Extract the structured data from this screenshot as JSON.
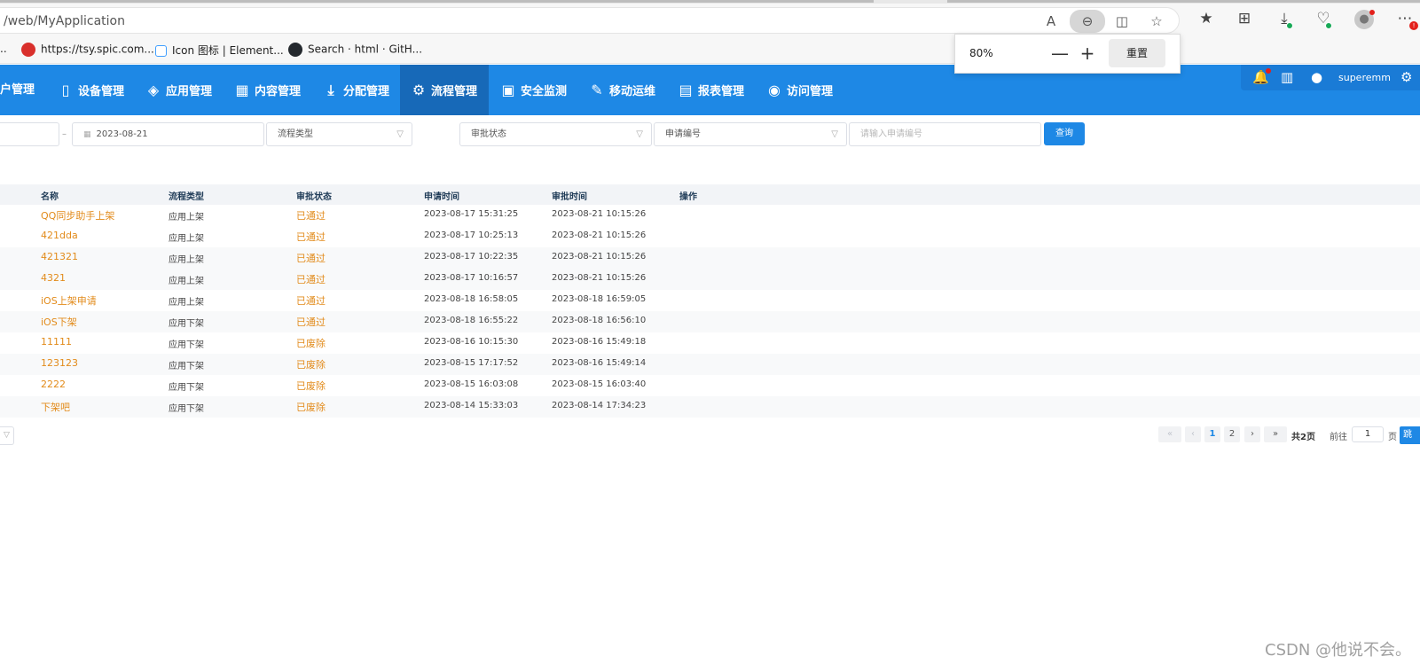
{
  "browser": {
    "url": "/web/MyApplication",
    "bookmarks": [
      {
        "label": "..",
        "icon": "ellipsis-icon"
      },
      {
        "label": "https://tsy.spic.com...",
        "icon": "site-favicon"
      },
      {
        "label": "Icon 图标 | Element...",
        "icon": "element-favicon"
      },
      {
        "label": "Search · html · GitH...",
        "icon": "github-icon"
      }
    ],
    "zoom": {
      "value": "80%",
      "minus": "—",
      "plus": "+",
      "reset": "重置"
    },
    "toolbar_icons": [
      "read-aloud-icon",
      "zoom-out-icon",
      "split-screen-icon",
      "favorite-star-icon",
      "favorites-icon",
      "collections-icon",
      "downloads-icon",
      "performance-icon",
      "profile-icon",
      "more-icon"
    ],
    "badge": "!"
  },
  "nav": {
    "items": [
      {
        "label": "户管理",
        "icon": ""
      },
      {
        "label": "设备管理",
        "icon": "device-icon"
      },
      {
        "label": "应用管理",
        "icon": "layers-icon"
      },
      {
        "label": "内容管理",
        "icon": "grid-icon"
      },
      {
        "label": "分配管理",
        "icon": "download-icon"
      },
      {
        "label": "流程管理",
        "icon": "gear-flow-icon"
      },
      {
        "label": "安全监测",
        "icon": "monitor-icon"
      },
      {
        "label": "移动运维",
        "icon": "wrench-icon"
      },
      {
        "label": "报表管理",
        "icon": "report-icon"
      },
      {
        "label": "访问管理",
        "icon": "access-icon"
      }
    ],
    "active_index": 5,
    "right": {
      "user": "superemm",
      "icons": [
        "bell-icon",
        "dashboard-icon",
        "user-icon",
        "settings-icon"
      ]
    }
  },
  "filters": {
    "date_sep": "–",
    "date_end": "2023-08-21",
    "process_type": "流程类型",
    "approval_status": "审批状态",
    "apply_no_select": "申请编号",
    "apply_no_placeholder": "请输入申请编号",
    "query": "查询"
  },
  "table": {
    "headers": [
      "名称",
      "流程类型",
      "审批状态",
      "申请时间",
      "审批时间",
      "操作"
    ],
    "rows": [
      {
        "name": "QQ同步助手上架",
        "type": "应用上架",
        "status": "已通过",
        "applied": "2023-08-17 15:31:25",
        "approved": "2023-08-21 10:15:26"
      },
      {
        "name": "421dda",
        "type": "应用上架",
        "status": "已通过",
        "applied": "2023-08-17 10:25:13",
        "approved": "2023-08-21 10:15:26"
      },
      {
        "name": "421321",
        "type": "应用上架",
        "status": "已通过",
        "applied": "2023-08-17 10:22:35",
        "approved": "2023-08-21 10:15:26"
      },
      {
        "name": "4321",
        "type": "应用上架",
        "status": "已通过",
        "applied": "2023-08-17 10:16:57",
        "approved": "2023-08-21 10:15:26"
      },
      {
        "name": "iOS上架申请",
        "type": "应用上架",
        "status": "已通过",
        "applied": "2023-08-18 16:58:05",
        "approved": "2023-08-18 16:59:05"
      },
      {
        "name": "iOS下架",
        "type": "应用下架",
        "status": "已通过",
        "applied": "2023-08-18 16:55:22",
        "approved": "2023-08-18 16:56:10"
      },
      {
        "name": "11111",
        "type": "应用下架",
        "status": "已废除",
        "applied": "2023-08-16 10:15:30",
        "approved": "2023-08-16 15:49:18"
      },
      {
        "name": "123123",
        "type": "应用下架",
        "status": "已废除",
        "applied": "2023-08-15 17:17:52",
        "approved": "2023-08-16 15:49:14"
      },
      {
        "name": "2222",
        "type": "应用下架",
        "status": "已废除",
        "applied": "2023-08-15 16:03:08",
        "approved": "2023-08-15 16:03:40"
      },
      {
        "name": "下架吧",
        "type": "应用下架",
        "status": "已废除",
        "applied": "2023-08-14 15:33:03",
        "approved": "2023-08-14 17:34:23"
      }
    ]
  },
  "pagination": {
    "first": "«",
    "prev": "‹",
    "pages": [
      "1",
      "2"
    ],
    "current": "1",
    "next": "›",
    "last": "»",
    "total": "共2页",
    "goto_label": "前往",
    "goto_value": "1",
    "page_unit": "页",
    "jump": "跳转"
  },
  "watermark": "CSDN @他说不会。",
  "colors": {
    "primary": "#1e88e5",
    "nav_active": "#1769b8",
    "link": "#e28b1b"
  }
}
